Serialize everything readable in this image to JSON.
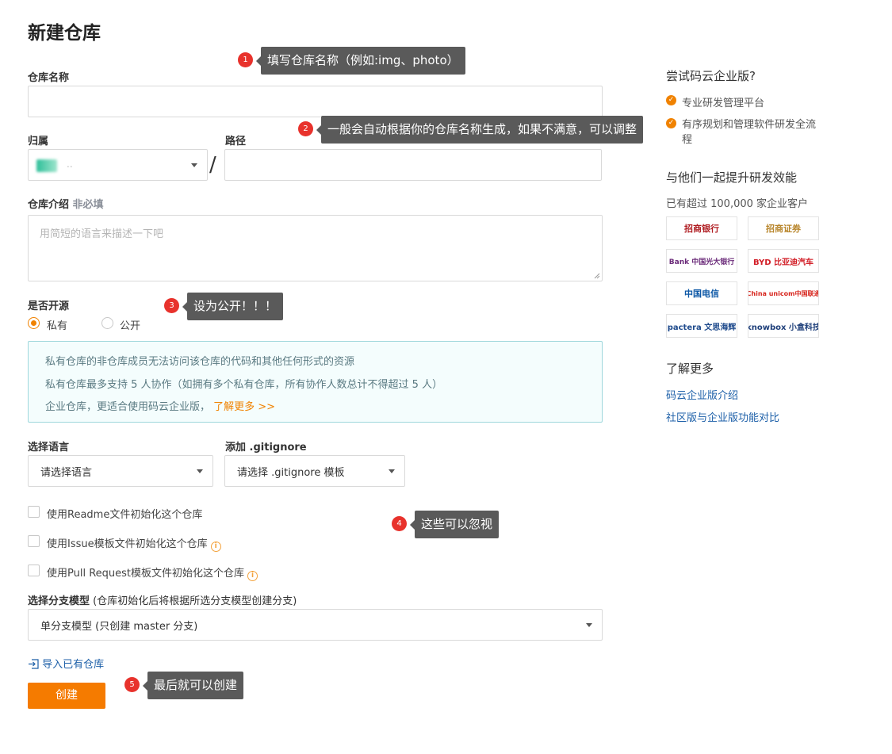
{
  "page": {
    "title": "新建仓库"
  },
  "form": {
    "name_label": "仓库名称",
    "name_value": "",
    "owner_label": "归属",
    "owner_value": "..",
    "path_label": "路径",
    "path_value": "",
    "path_separator": "/",
    "desc_label": "仓库介绍",
    "desc_optional": "非必填",
    "desc_placeholder": "用简短的语言来描述一下吧",
    "opensource_label": "是否开源",
    "option_private": "私有",
    "option_public": "公开",
    "selected_visibility": "私有",
    "info_lines": [
      "私有仓库的非仓库成员无法访问该仓库的代码和其他任何形式的资源",
      "私有仓库最多支持 5 人协作（如拥有多个私有仓库，所有协作人数总计不得超过 5 人）",
      "企业仓库，更适合使用码云企业版，"
    ],
    "info_link": "了解更多 >>",
    "language_label": "选择语言",
    "language_value": "请选择语言",
    "gitignore_label": "添加 .gitignore",
    "gitignore_value": "请选择 .gitignore 模板",
    "checkboxes": [
      "使用Readme文件初始化这个仓库",
      "使用Issue模板文件初始化这个仓库",
      "使用Pull Request模板文件初始化这个仓库"
    ],
    "branch_label": "选择分支模型",
    "branch_hint": "(仓库初始化后将根据所选分支模型创建分支)",
    "branch_value": "单分支模型 (只创建 master 分支)",
    "import_link": "导入已有仓库",
    "create_button": "创建"
  },
  "annotations": [
    {
      "num": "1",
      "text": "填写仓库名称（例如:img、photo）"
    },
    {
      "num": "2",
      "text": "一般会自动根据你的仓库名称生成，如果不满意，可以调整"
    },
    {
      "num": "3",
      "text": "设为公开！！！"
    },
    {
      "num": "4",
      "text": "这些可以忽视"
    },
    {
      "num": "5",
      "text": "最后就可以创建"
    }
  ],
  "sidebar": {
    "enterprise_title": "尝试码云企业版?",
    "features": [
      "专业研发管理平台",
      "有序规划和管理软件研发全流程"
    ],
    "together_title": "与他们一起提升研发效能",
    "customers_text": "已有超过 100,000 家企业客户",
    "logos": [
      "招商银行",
      "招商证券",
      "Bank 中国光大银行",
      "BYD 比亚迪汽车",
      "中国电信",
      "China unicom中国联通",
      "pactera 文思海辉",
      "knowbox 小盒科技"
    ],
    "learn_more_title": "了解更多",
    "links": [
      "码云企业版介绍",
      "社区版与企业版功能对比"
    ]
  },
  "colors": {
    "accent": "#f08200",
    "link": "#1c5fa8",
    "badge": "#e8322c",
    "tip_bg": "#5a5a5a"
  }
}
